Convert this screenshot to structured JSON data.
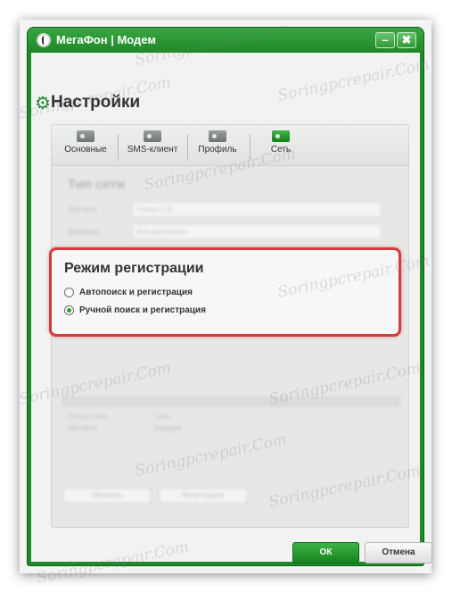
{
  "window": {
    "title": "МегаФон | Модем",
    "minimize_label": "–",
    "close_label": "✖"
  },
  "header": {
    "title": "Настройки",
    "gear_glyph": "⚙"
  },
  "tabs": [
    {
      "label": "Основные",
      "icon": "gear-card-icon",
      "active": false
    },
    {
      "label": "SMS-клиент",
      "icon": "gear-card-icon",
      "active": false
    },
    {
      "label": "Профиль",
      "icon": "gear-card-icon",
      "active": false
    },
    {
      "label": "Сеть",
      "icon": "network-card-icon",
      "active": true
    }
  ],
  "registration": {
    "title": "Режим регистрации",
    "options": [
      {
        "label": "Автопоиск и регистрация",
        "selected": false
      },
      {
        "label": "Ручной поиск и регистрация",
        "selected": true
      }
    ]
  },
  "buttons": {
    "ok": "ОК",
    "cancel": "Отмена"
  },
  "watermark": "Soringpcrepair.Com",
  "colors": {
    "accent": "#1f8a2a",
    "highlight": "#d43a3a"
  }
}
